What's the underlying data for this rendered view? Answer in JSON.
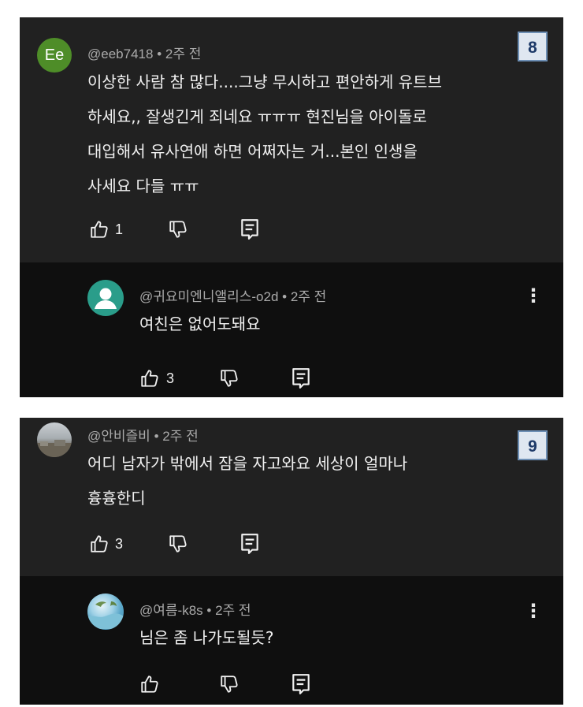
{
  "threads": [
    {
      "badge": "8",
      "comment": {
        "avatar_initials": "Ee",
        "handle": "@eeb7418",
        "time": "2주 전",
        "lines": [
          "이상한 사람 참 많다....그냥 무시하고 편안하게 유트브",
          "하세요,, 잘생긴게 죄네요 ㅠㅠㅠ 현진님을 아이돌로",
          "대입해서 유사연애 하면 어쩌자는 거...본인 인생을",
          "사세요 다들 ㅠㅠ"
        ],
        "likes": "1"
      },
      "reply": {
        "avatar_icon": "person-icon",
        "handle": "@귀요미엔니앨리스-o2d",
        "time": "2주 전",
        "lines": [
          "여친은 없어도돼요"
        ],
        "likes": "3"
      }
    },
    {
      "badge": "9",
      "comment": {
        "avatar_icon": "photo-avatar",
        "handle": "@안비즐비",
        "time": "2주 전",
        "lines": [
          "어디 남자가 밖에서 잠을 자고와요 세상이 얼마나",
          "흉흉한디"
        ],
        "likes": "3"
      },
      "reply": {
        "avatar_icon": "photo-avatar",
        "handle": "@여름-k8s",
        "time": "2주 전",
        "lines": [
          "님은 좀 나가도될듯?"
        ],
        "likes": ""
      }
    }
  ],
  "separator": "•",
  "colors": {
    "comment_bg": "#212121",
    "reply_bg": "#0f0f0f",
    "meta_text": "#aaaaaa",
    "body_text": "#f1f1f1",
    "avatar_ee": "#4e8d28",
    "avatar_person": "#2a9d8a",
    "badge_border": "#6d8fb5"
  }
}
